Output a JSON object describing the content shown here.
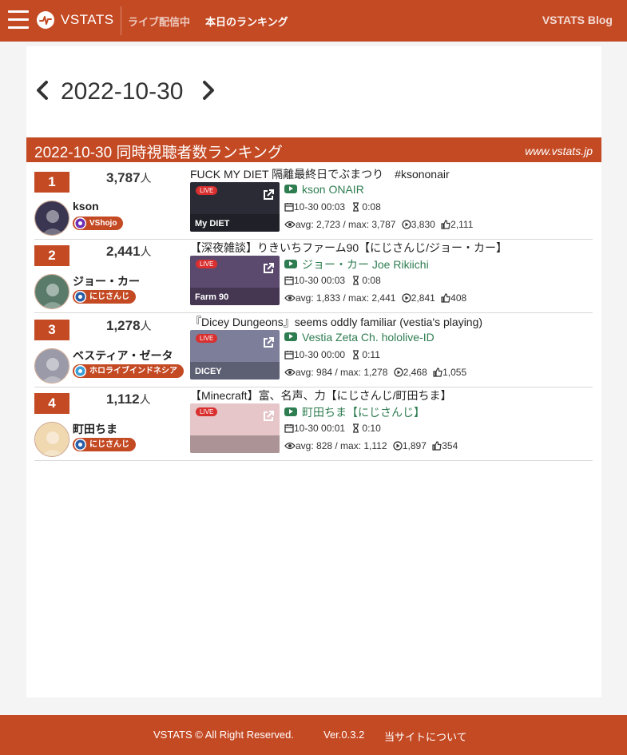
{
  "navbar": {
    "brand": "VSTATS",
    "live_link": "ライブ配信中",
    "ranking_link": "本日のランキング",
    "blog_link": "VSTATS Blog"
  },
  "date_nav": {
    "date": "2022-10-30"
  },
  "ranking": {
    "title": "2022-10-30 同時視聴者数ランキング",
    "site": "www.vstats.jp",
    "unit": "人",
    "rows": [
      {
        "rank": "1",
        "viewers": "3,787",
        "name": "kson",
        "group": "VShojo",
        "stream_title": "FUCK MY DIET 隔離最終日でぶまつり　#ksononair",
        "channel": "kson ONAIR",
        "start": "10-30 00:03",
        "duration": "0:08",
        "avg_max": "avg: 2,723 / max: 3,787",
        "views": "3,830",
        "likes": "2,111",
        "live_tag": "LIVE",
        "thumb_text": "My DIET",
        "colors": {
          "thumb_bg": "#2b2b36",
          "avatar_bg": "#3a3550",
          "group_icon": "#6d2fb3"
        }
      },
      {
        "rank": "2",
        "viewers": "2,441",
        "name": "ジョー・カー",
        "group": "にじさんじ",
        "stream_title": "【深夜雑談】りきいちファーム90【にじさんじ/ジョー・カー】",
        "channel": "ジョー・カー Joe Rikiichi",
        "start": "10-30 00:03",
        "duration": "0:08",
        "avg_max": "avg: 1,833 / max: 2,441",
        "views": "2,841",
        "likes": "408",
        "live_tag": "LIVE",
        "thumb_text": "Farm 90",
        "colors": {
          "thumb_bg": "#5c4a6e",
          "avatar_bg": "#5a7a6a",
          "group_icon": "#2a5ea8"
        }
      },
      {
        "rank": "3",
        "viewers": "1,278",
        "name": "ベスティア・ゼータ",
        "group": "ホロライブインドネシア",
        "stream_title": "『Dicey Dungeons』seems oddly familiar (vestia's playing)",
        "channel": "Vestia Zeta Ch. hololive-ID",
        "start": "10-30 00:00",
        "duration": "0:11",
        "avg_max": "avg: 984 / max: 1,278",
        "views": "2,468",
        "likes": "1,055",
        "live_tag": "LIVE",
        "thumb_text": "DICEY",
        "colors": {
          "thumb_bg": "#7d7f9a",
          "avatar_bg": "#9a9aa8",
          "group_icon": "#3aa0d8"
        }
      },
      {
        "rank": "4",
        "viewers": "1,112",
        "name": "町田ちま",
        "group": "にじさんじ",
        "stream_title": "【Minecraft】富、名声、力【にじさんじ/町田ちま】",
        "channel": "町田ちま【にじさんじ】",
        "start": "10-30 00:01",
        "duration": "0:10",
        "avg_max": "avg: 828 / max: 1,112",
        "views": "1,897",
        "likes": "354",
        "live_tag": "LIVE",
        "thumb_text": "",
        "colors": {
          "thumb_bg": "#e6c6c8",
          "avatar_bg": "#f0d8b0",
          "group_icon": "#2a5ea8"
        }
      }
    ]
  },
  "footer": {
    "copyright": "VSTATS © All Right Reserved.",
    "version": "Ver.0.3.2",
    "about": "当サイトについて"
  },
  "colors": {
    "accent": "#c44a24",
    "channel_link": "#2e7d50",
    "live_red": "#d92f2f"
  },
  "icons": {
    "menu": "hamburger-menu-icon",
    "logo": "pulse-logo-icon",
    "prev": "chevron-left-icon",
    "next": "chevron-right-icon",
    "youtube": "youtube-icon",
    "calendar": "calendar-icon",
    "duration": "hourglass-icon",
    "eye": "eye-icon",
    "views": "play-circle-icon",
    "likes": "thumbs-up-icon",
    "external": "external-link-icon"
  }
}
